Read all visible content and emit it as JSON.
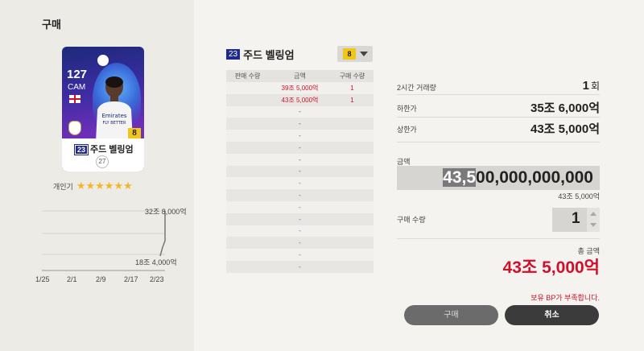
{
  "window": {
    "title": "구매"
  },
  "card": {
    "ovr": "127",
    "position": "CAM",
    "season_badge": "23",
    "name": "주드 벨링엄",
    "level": "8",
    "rank": "27"
  },
  "popularity": {
    "label": "개인기",
    "stars": "★★★★★★",
    "count": 6
  },
  "price_chart": {
    "x_labels": [
      "1/25",
      "2/1",
      "2/9",
      "2/17",
      "2/23"
    ],
    "high_label": "32조 8,000억",
    "low_label": "18조 4,000억"
  },
  "chart_data": {
    "type": "line",
    "x": [
      "1/25",
      "2/1",
      "2/9",
      "2/17",
      "2/23"
    ],
    "annotations": [
      "32조 8,000억",
      "18조 4,000억"
    ]
  },
  "listing": {
    "season": "23",
    "name": "주드 벨링엄",
    "level_selected": "8",
    "headers": [
      "판매 수량",
      "금액",
      "구매 수량"
    ],
    "rows": [
      {
        "sell_qty": "",
        "price": "39조 5,000억",
        "buy_qty": "1",
        "color": "red"
      },
      {
        "sell_qty": "",
        "price": "43조 5,000억",
        "buy_qty": "1",
        "color": "red"
      },
      {
        "sell_qty": "",
        "price": "-",
        "buy_qty": "",
        "color": "red"
      },
      {
        "sell_qty": "",
        "price": "-",
        "buy_qty": "",
        "color": "red"
      },
      {
        "sell_qty": "",
        "price": "-",
        "buy_qty": "",
        "color": "red"
      },
      {
        "sell_qty": "",
        "price": "-",
        "buy_qty": "",
        "color": "red"
      },
      {
        "sell_qty": "",
        "price": "-",
        "buy_qty": "",
        "color": "red"
      },
      {
        "sell_qty": "",
        "price": "-",
        "buy_qty": "",
        "color": "red"
      },
      {
        "sell_qty": "",
        "price": "-",
        "buy_qty": "",
        "color": "blue"
      },
      {
        "sell_qty": "",
        "price": "-",
        "buy_qty": "",
        "color": "blue"
      },
      {
        "sell_qty": "",
        "price": "-",
        "buy_qty": "",
        "color": "blue"
      },
      {
        "sell_qty": "",
        "price": "-",
        "buy_qty": "",
        "color": "blue"
      },
      {
        "sell_qty": "",
        "price": "-",
        "buy_qty": "",
        "color": "blue"
      },
      {
        "sell_qty": "",
        "price": "-",
        "buy_qty": "",
        "color": "blue"
      },
      {
        "sell_qty": "",
        "price": "-",
        "buy_qty": "",
        "color": "blue"
      },
      {
        "sell_qty": "",
        "price": "-",
        "buy_qty": "",
        "color": "blue"
      }
    ]
  },
  "stats": {
    "trade_label": "2시간 거래량",
    "trade_value": "1",
    "trade_unit": "회",
    "low_label": "하한가",
    "low_value": "35조 6,000억",
    "high_label": "상한가",
    "high_value": "43조 5,000억"
  },
  "amount": {
    "label": "금액",
    "value_highlight": "43,5",
    "value_rest": "00,000,000,000",
    "sub": "43조 5,000억"
  },
  "quantity": {
    "label": "구매 수량",
    "value": "1"
  },
  "total": {
    "label": "총 금액",
    "value": "43조 5,000억"
  },
  "warning": "보유 BP가 부족합니다.",
  "buttons": {
    "buy": "구매",
    "cancel": "취소"
  },
  "colors": {
    "red": "#d0102a",
    "blue": "#2a78c8",
    "star": "#f3b62a",
    "level": "#f2c617"
  }
}
